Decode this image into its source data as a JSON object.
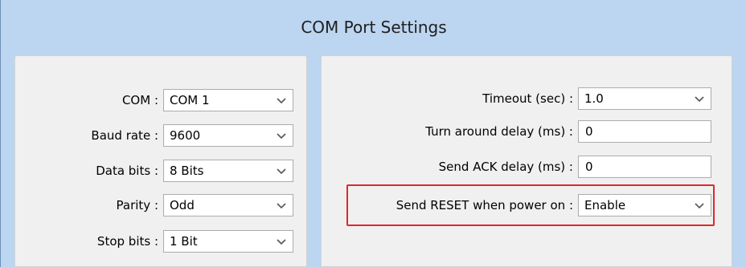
{
  "dialog": {
    "title": "COM Port Settings"
  },
  "left": {
    "com": {
      "label": "COM :",
      "value": "COM 1"
    },
    "baud": {
      "label": "Baud rate :",
      "value": "9600"
    },
    "data_bits": {
      "label": "Data bits :",
      "value": "8 Bits"
    },
    "parity": {
      "label": "Parity :",
      "value": "Odd"
    },
    "stop_bits": {
      "label": "Stop bits :",
      "value": "1 Bit"
    }
  },
  "right": {
    "timeout": {
      "label": "Timeout (sec) :",
      "value": "1.0"
    },
    "turn_around": {
      "label": "Turn around delay (ms) :",
      "value": "0"
    },
    "send_ack": {
      "label": "Send ACK delay (ms) :",
      "value": "0"
    },
    "send_reset": {
      "label": "Send RESET when power on :",
      "value": "Enable"
    }
  },
  "icons": {
    "dropdown": "chevron-down-icon"
  },
  "colors": {
    "highlight": "#e0262f",
    "title_bg": "#bcd5f0"
  }
}
